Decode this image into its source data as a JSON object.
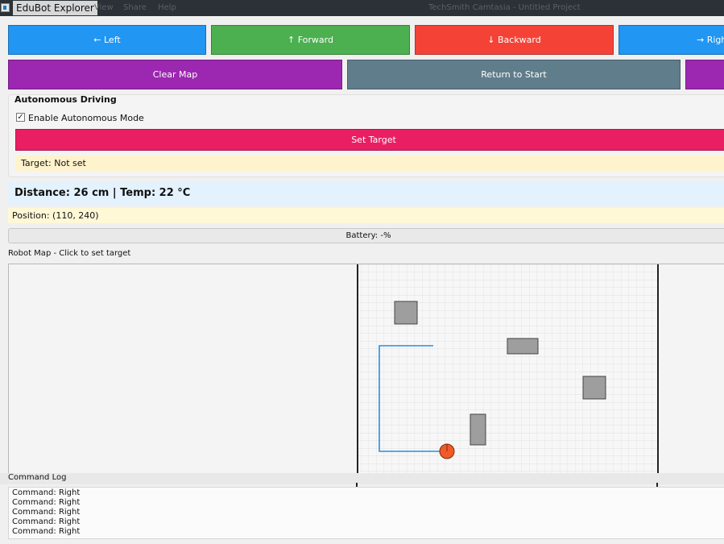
{
  "window": {
    "app_title": "EduBot Explorer",
    "background_menu": [
      "View",
      "Share",
      "Help"
    ],
    "background_title": "TechSmith Camtasia - Untitled Project"
  },
  "controls": {
    "row1": [
      {
        "label": "← Left",
        "color": "#2196f3"
      },
      {
        "label": "↑ Forward",
        "color": "#4caf50"
      },
      {
        "label": "↓ Backward",
        "color": "#f44336"
      },
      {
        "label": "→ Right",
        "color": "#2196f3"
      }
    ],
    "row2": [
      {
        "label": "Clear Map",
        "color": "#9c27b0"
      },
      {
        "label": "Return to Start",
        "color": "#607d8b"
      }
    ]
  },
  "autonomous": {
    "heading": "Autonomous Driving",
    "enable_label": "Enable Autonomous Mode",
    "enabled": true,
    "set_target_label": "Set Target",
    "set_target_color": "#e91e63",
    "target_status": "Target: Not set"
  },
  "status": {
    "sensors": "Distance: 26 cm | Temp: 22 °C",
    "position": "Position: (110, 240)",
    "battery": "Battery: -%"
  },
  "map": {
    "label": "Robot Map - Click to set target",
    "path_color": "#2a8ee0",
    "robot_color": "#f05a28"
  },
  "command_log": {
    "label": "Command Log",
    "entries": [
      "Command: Right",
      "Command: Right",
      "Command: Right",
      "Command: Right",
      "Command: Right"
    ]
  }
}
